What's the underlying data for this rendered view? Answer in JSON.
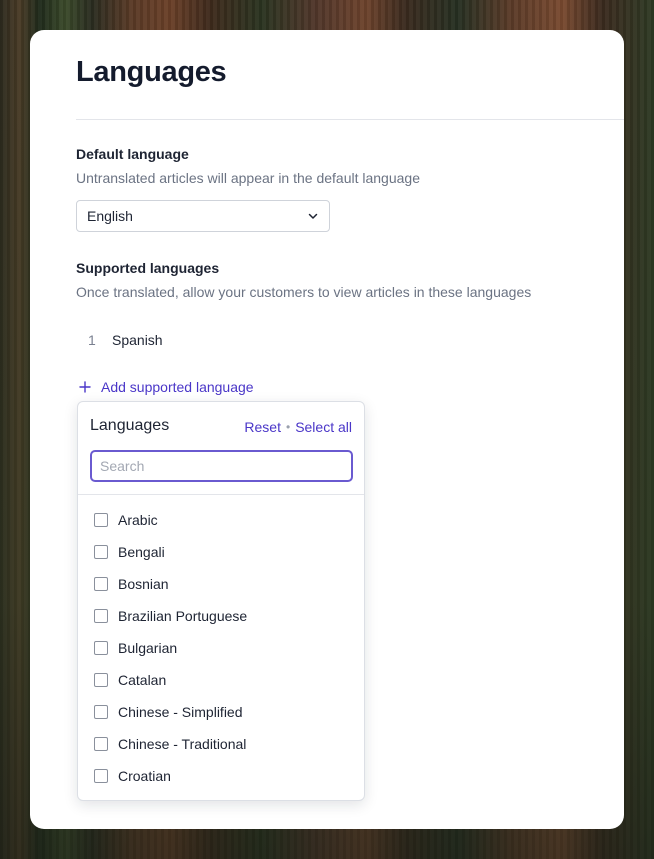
{
  "page": {
    "title": "Languages"
  },
  "default_language": {
    "label": "Default language",
    "help": "Untranslated articles will appear in the default language",
    "selected": "English"
  },
  "supported_languages": {
    "label": "Supported languages",
    "help": "Once translated, allow your customers to view articles in these languages",
    "items": [
      {
        "number": "1",
        "name": "Spanish"
      }
    ],
    "add_label": "Add supported language"
  },
  "dropdown": {
    "title": "Languages",
    "reset_label": "Reset",
    "separator": "•",
    "select_all_label": "Select all",
    "search_placeholder": "Search",
    "options": [
      {
        "label": "Arabic",
        "checked": false
      },
      {
        "label": "Bengali",
        "checked": false
      },
      {
        "label": "Bosnian",
        "checked": false
      },
      {
        "label": "Brazilian Portuguese",
        "checked": false
      },
      {
        "label": "Bulgarian",
        "checked": false
      },
      {
        "label": "Catalan",
        "checked": false
      },
      {
        "label": "Chinese - Simplified",
        "checked": false
      },
      {
        "label": "Chinese - Traditional",
        "checked": false
      },
      {
        "label": "Croatian",
        "checked": false
      }
    ]
  },
  "colors": {
    "accent": "#4a36c8",
    "title": "#141b2d",
    "muted": "#6b7383"
  }
}
